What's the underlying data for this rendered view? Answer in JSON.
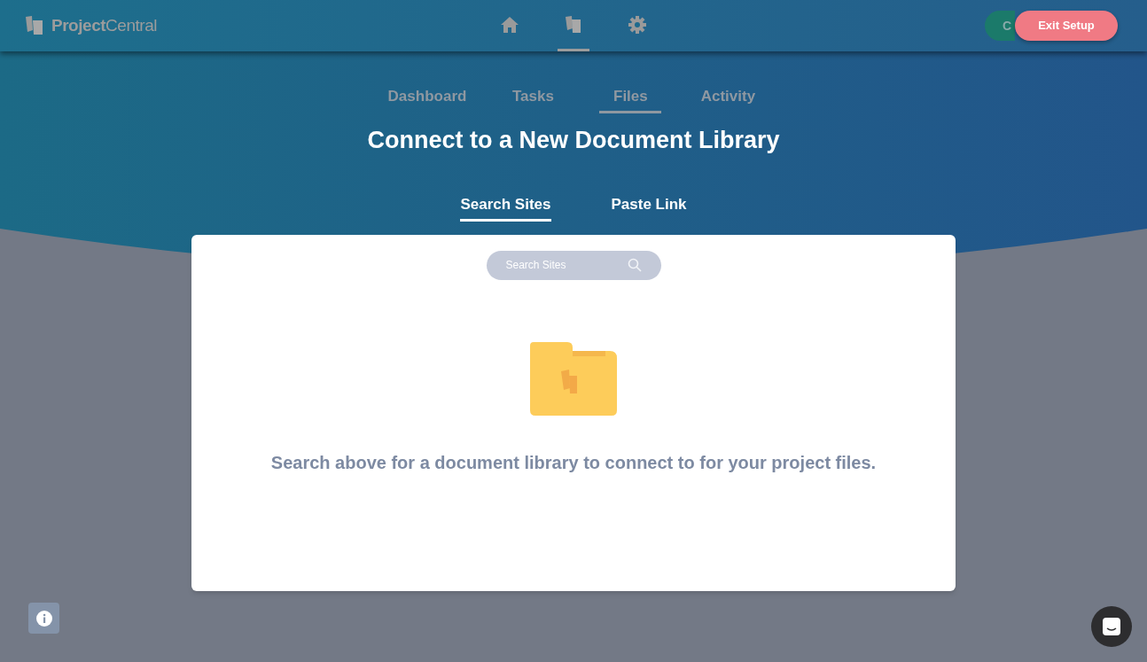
{
  "header": {
    "logo": "**Project**Central",
    "nav": [
      {
        "kind": "home",
        "selected": false
      },
      {
        "kind": "files",
        "selected": true
      },
      {
        "kind": "settings",
        "selected": false
      }
    ],
    "covered_button": "C",
    "exit_button": "Exit Setup"
  },
  "tabs": [
    {
      "label": "Dashboard",
      "selected": false
    },
    {
      "label": "Tasks",
      "selected": false
    },
    {
      "label": "Files",
      "selected": true
    },
    {
      "label": "Activity",
      "selected": false
    }
  ],
  "title": "Connect to a New Document Library",
  "subtabs": [
    {
      "label": "Search Sites",
      "selected": true
    },
    {
      "label": "Paste Link",
      "selected": false
    }
  ],
  "search": {
    "placeholder": "Search Sites"
  },
  "message": "Search above for a document library to connect to for your project files."
}
